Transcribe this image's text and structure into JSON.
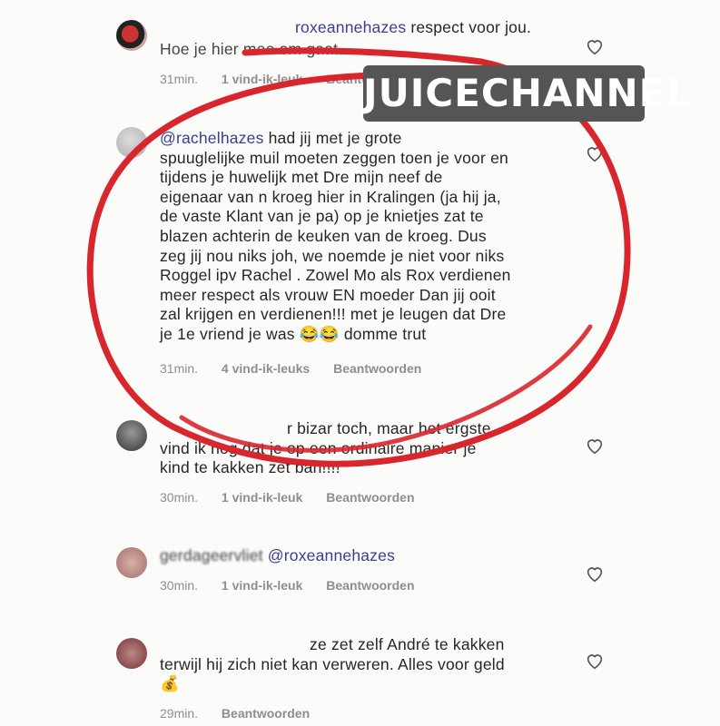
{
  "watermark": "JUICECHANNEL",
  "comments": [
    {
      "user": "roxeannehazes",
      "text_user_part": "roxeannehazes",
      "text": " respect voor jou.",
      "line2": "Hoe je hier mee om gaat.",
      "time": "31min.",
      "likes": "1 vind-ik-leuk",
      "reply": "Beantwoorden"
    },
    {
      "mention": "@rachelhazes",
      "lines": [
        " had jij met je grote",
        "spuuglelijke muil moeten zeggen toen je voor en",
        "tijdens je huwelijk met Dre mijn neef de",
        "eigenaar van n kroeg hier in Kralingen (ja hij ja,",
        "de vaste Klant van je pa) op je knietjes zat te",
        "blazen achterin de keuken van de kroeg. Dus",
        "zeg jij nou niks joh, we noemde je niet voor niks",
        "Roggel ipv Rachel . Zowel Mo als Rox verdienen",
        "meer respect als vrouw EN moeder Dan jij ooit",
        "zal krijgen en verdienen!!! met je leugen dat Dre",
        "je 1e vriend je was 😂😂 domme trut"
      ],
      "time": "31min.",
      "likes": "4 vind-ik-leuks",
      "reply": "Beantwoorden"
    },
    {
      "lines": [
        "r bizar toch, maar het ergste",
        "vind ik nog dat je op een ordinaire manier je",
        "kind te kakken zet ban!!!!"
      ],
      "time": "30min.",
      "likes": "1 vind-ik-leuk",
      "reply": "Beantwoorden"
    },
    {
      "mention": "@roxeannehazes",
      "user_blur": "gerdageervliet",
      "time": "30min.",
      "likes": "1 vind-ik-leuk",
      "reply": "Beantwoorden"
    },
    {
      "lines": [
        "ze zet zelf André te kakken",
        "terwijl hij zich niet kan verweren. Alles voor geld",
        "💰"
      ],
      "time": "29min.",
      "reply": "Beantwoorden"
    }
  ]
}
